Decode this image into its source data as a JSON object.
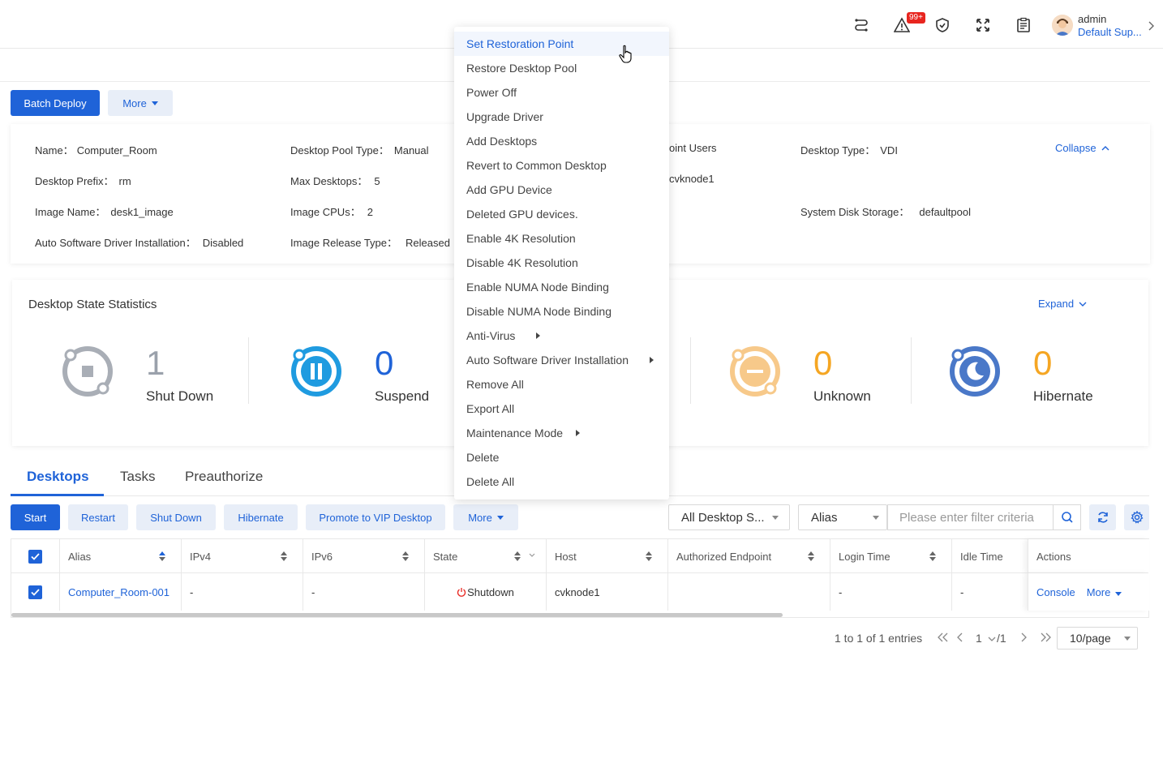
{
  "topbar": {
    "notification_badge": "99+",
    "user": {
      "name": "admin",
      "role": "Default Sup..."
    }
  },
  "toolbar": {
    "batch_deploy": "Batch Deploy",
    "more": "More"
  },
  "info": {
    "name": {
      "k": "Name：",
      "v": "Computer_Room"
    },
    "pool_type": {
      "k": "Desktop Pool Type：",
      "v": "Manual"
    },
    "endpoint_users": "oint Users",
    "desktop_type": {
      "k": "Desktop Type：",
      "v": "VDI"
    },
    "collapse": "Collapse",
    "prefix": {
      "k": "Desktop Prefix：",
      "v": "rm"
    },
    "max_desktops": {
      "k": "Max Desktops：",
      "v": "5"
    },
    "host_partial": "cvknode1",
    "image_name": {
      "k": "Image Name：",
      "v": "desk1_image"
    },
    "image_cpus": {
      "k": "Image CPUs：",
      "v": "2"
    },
    "sys_disk": {
      "k": "System Disk Storage：",
      "v": "defaultpool"
    },
    "auto_driver": {
      "k": "Auto Software Driver Installation：",
      "v": "Disabled"
    },
    "release_type": {
      "k": "Image Release Type：",
      "v": "Released"
    }
  },
  "stats": {
    "title": "Desktop State Statistics",
    "expand": "Expand",
    "items": [
      {
        "value": "1",
        "label": "Shut Down",
        "color": "#9aa1ab"
      },
      {
        "value": "0",
        "label": "Suspend",
        "color": "#1f63d8"
      },
      {
        "value": "0",
        "label": "Unknown",
        "color": "#f5a623"
      },
      {
        "value": "0",
        "label": "Hibernate",
        "color": "#f5a623"
      }
    ]
  },
  "tabs": [
    "Desktops",
    "Tasks",
    "Preauthorize"
  ],
  "actions": {
    "start": "Start",
    "restart": "Restart",
    "shutdown": "Shut Down",
    "hibernate": "Hibernate",
    "promote": "Promote to VIP Desktop",
    "more": "More"
  },
  "filters": {
    "state_select": "All Desktop S...",
    "field_select": "Alias",
    "placeholder": "Please enter filter criteria"
  },
  "table": {
    "headers": [
      "Alias",
      "IPv4",
      "IPv6",
      "State",
      "Host",
      "Authorized Endpoint",
      "Login Time",
      "Idle Time",
      "Actions"
    ],
    "row": {
      "alias": "Computer_Room-001",
      "ipv4": "-",
      "ipv6": "-",
      "state": "Shutdown",
      "host": "cvknode1",
      "endpoint": "",
      "login": "-",
      "idle": "-",
      "console": "Console",
      "more": "More"
    }
  },
  "pagination": {
    "summary": "1 to 1 of 1 entries",
    "page": "1",
    "total": "/1",
    "page_size": "10/page"
  },
  "menu": {
    "items": [
      "Set Restoration Point",
      "Restore Desktop Pool",
      "Power Off",
      "Upgrade Driver",
      "Add Desktops",
      "Revert to Common Desktop",
      "Add GPU Device",
      "Deleted GPU devices.",
      "Enable 4K Resolution",
      "Disable 4K Resolution",
      "Enable NUMA Node Binding",
      "Disable NUMA Node Binding",
      "Anti-Virus",
      "Auto Software Driver Installation",
      "Remove All",
      "Export All",
      "Maintenance Mode",
      "Delete",
      "Delete All"
    ]
  }
}
